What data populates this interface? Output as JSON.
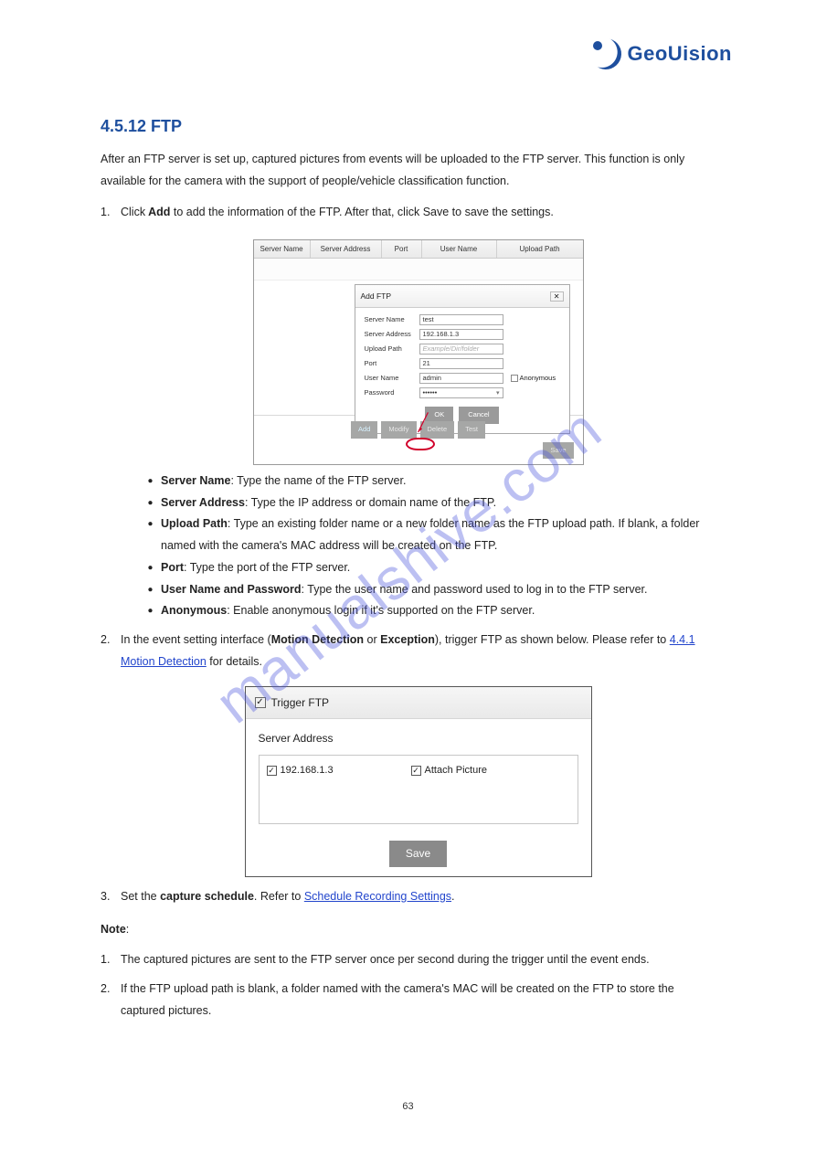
{
  "logo": {
    "brand": "GeoUision"
  },
  "section_title": "4.5.12 FTP",
  "intro": "After an FTP server is set up, captured pictures from events will be uploaded to the FTP server. This function is only available for the camera with the support of people/vehicle classification function.",
  "step1_prefix": "Click",
  "step1_bold": " Add ",
  "step1_suffix": "to add the information of the FTP. After that, click Save to save the settings.",
  "table_headers": {
    "server_name": "Server Name",
    "server_address": "Server Address",
    "port": "Port",
    "user_name": "User Name",
    "upload_path": "Upload Path"
  },
  "dialog": {
    "title": "Add FTP",
    "close": "✕",
    "labels": {
      "server_name": "Server Name",
      "server_address": "Server Address",
      "upload_path": "Upload Path",
      "port": "Port",
      "user_name": "User Name",
      "password": "Password",
      "anonymous": "Anonymous"
    },
    "values": {
      "server_name": "test",
      "server_address": "192.168.1.3",
      "upload_path_ph": "Example/Dir/folder",
      "port": "21",
      "user_name": "admin",
      "password": "••••••"
    },
    "buttons": {
      "ok": "OK",
      "cancel": "Cancel"
    }
  },
  "footer_buttons": {
    "add": "Add",
    "modify": "Modify",
    "delete": "Delete",
    "test": "Test",
    "save": "Save"
  },
  "bullets": {
    "b1a": "Server Name",
    "b1b": ": Type the name of the FTP server.",
    "b2a": "Server Address",
    "b2b": ": Type the IP address or domain name of the FTP.",
    "b3a": "Upload Path",
    "b3b": ": Type an existing folder name or a new folder name as the FTP upload path. If blank, a folder named with the camera's MAC address will be created on the FTP.",
    "b4a": "Port",
    "b4b": ": Type the port of the FTP server.",
    "b5a": "User Name and Password",
    "b5b": ": Type the user name and password used to log in to the FTP server.",
    "b6a": "Anonymous",
    "b6b": ": Enable anonymous login if it's supported on the FTP server."
  },
  "step2_a": "In the event setting interface (",
  "step2_b": "),",
  "step2_b2": " or ",
  "step2_c": "Motion Detection",
  "step2_c2": "Exception",
  "step2_d": "trigger FTP as shown below. Please refer to ",
  "step2_link": "4.4.1 Motion Detection",
  "step2_e": "for details.",
  "shot2": {
    "trigger_label": "Trigger FTP",
    "server_address_label": "Server Address",
    "ip": "192.168.1.3",
    "attach": "Attach Picture",
    "save": "Save"
  },
  "step3_a": "Set the ",
  "step3_b": "capture schedule",
  "step3_c": ". Refer to ",
  "step3_link": "Schedule Recording Settings",
  "step3_d": ".",
  "note_label": "Note",
  "notes": {
    "n1": "The captured pictures are sent to the FTP server once per second during the trigger until the event ends.",
    "n2": "If the FTP upload path is blank, a folder named with the camera's MAC will be created on the FTP to store the captured pictures."
  },
  "watermark": "manualshive.com",
  "page_number": "63"
}
